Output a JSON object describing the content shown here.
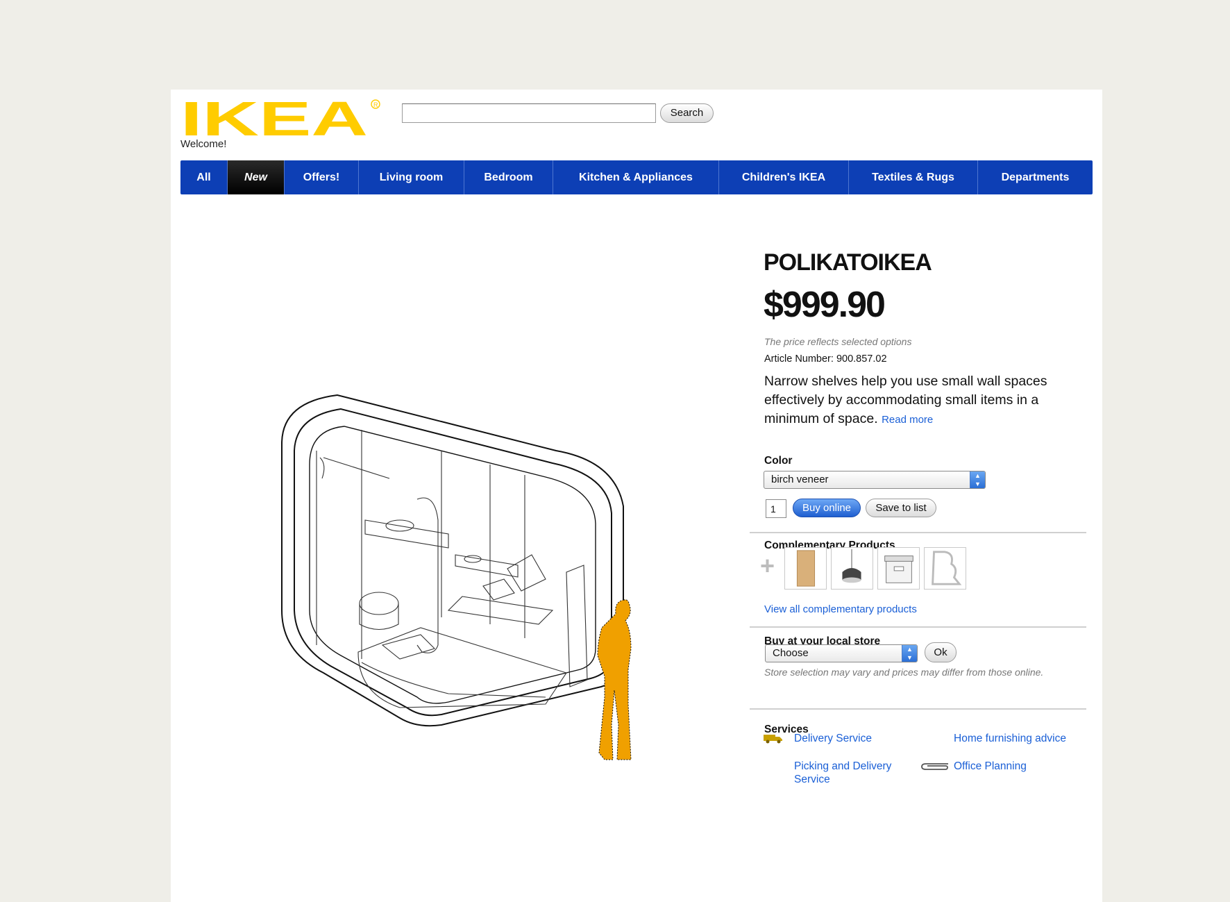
{
  "header": {
    "logo_text": "IKEA",
    "welcome": "Welcome!",
    "search": {
      "value": "",
      "button_label": "Search"
    }
  },
  "nav": {
    "items": [
      {
        "label": "All"
      },
      {
        "label": "New",
        "active": true
      },
      {
        "label": "Offers!"
      },
      {
        "label": "Living room"
      },
      {
        "label": "Bedroom"
      },
      {
        "label": "Kitchen & Appliances"
      },
      {
        "label": "Children's IKEA"
      },
      {
        "label": "Textiles & Rugs"
      },
      {
        "label": "Departments"
      }
    ]
  },
  "product": {
    "name": "POLIKATOIKEA",
    "price": "$999.90",
    "price_note": "The price reflects selected options",
    "article_label": "Article Number:",
    "article_number": "900.857.02",
    "description": "Narrow shelves help you use small wall spaces effectively by accommodating small items in a minimum of space.",
    "read_more": "Read more",
    "color_label": "Color",
    "color_value": "birch veneer",
    "quantity": "1",
    "buy_label": "Buy online",
    "save_label": "Save to list"
  },
  "complementary": {
    "title": "Complementary Products",
    "thumbnails": [
      "wood-panel",
      "pendant-lamp",
      "storage-box",
      "magazine-rack"
    ],
    "view_all": "View all complementary products"
  },
  "store": {
    "title": "Buy at your local store",
    "select_value": "Choose",
    "ok_label": "Ok",
    "note": "Store selection may vary and prices may differ from those online."
  },
  "services": {
    "title": "Services",
    "items": [
      {
        "label": "Delivery Service",
        "icon": "truck-icon"
      },
      {
        "label": "Home furnishing advice"
      },
      {
        "label": "Picking and Delivery Service"
      },
      {
        "label": "Office Planning",
        "icon": "paperclip-icon"
      }
    ]
  },
  "colors": {
    "nav_blue": "#0d3fb5",
    "brand_yellow": "#ffcc00",
    "link_blue": "#1a5fd6",
    "silhouette": "#f0a000"
  }
}
